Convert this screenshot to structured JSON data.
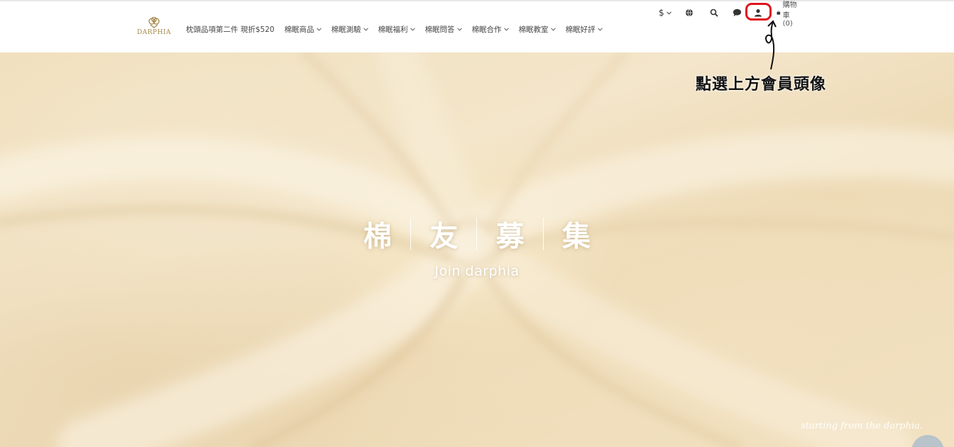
{
  "brand": {
    "logo_text": "DARPHIA"
  },
  "nav": {
    "items": [
      {
        "label": "枕頭品項第二件 現折$520",
        "has_dropdown": false
      },
      {
        "label": "棉眠商品",
        "has_dropdown": true
      },
      {
        "label": "棉眠測驗",
        "has_dropdown": true
      },
      {
        "label": "棉眠福利",
        "has_dropdown": true
      },
      {
        "label": "棉眠問答",
        "has_dropdown": true
      },
      {
        "label": "棉眠合作",
        "has_dropdown": true
      },
      {
        "label": "棉眠教室",
        "has_dropdown": true
      },
      {
        "label": "棉眠好評",
        "has_dropdown": true
      }
    ]
  },
  "utility": {
    "currency_symbol": "$",
    "icons": [
      "chevron-down-icon",
      "globe-icon",
      "search-icon",
      "chat-icon",
      "account-icon",
      "shopping-bag-icon"
    ],
    "cart_label": "購物車(0)"
  },
  "annotation": {
    "text": "點選上方會員頭像",
    "highlight_color": "#e0151c"
  },
  "hero": {
    "title_chars": [
      "棉",
      "友",
      "募",
      "集"
    ],
    "subtitle": "Join darphia",
    "script_text": "starting from the darphia."
  },
  "colors": {
    "brand_gold": "#a4884a",
    "hero_cream": "#f2e3c4",
    "nav_text": "#444444"
  }
}
